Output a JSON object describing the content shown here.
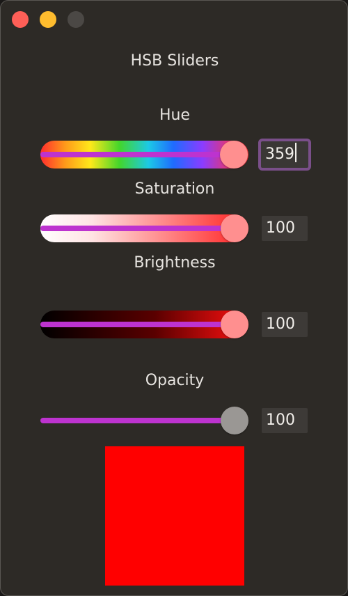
{
  "window": {
    "title": "HSB Sliders"
  },
  "sliders": [
    {
      "id": "hue",
      "label": "Hue",
      "value": "359",
      "max": 359,
      "fraction": 0.9972
    },
    {
      "id": "saturation",
      "label": "Saturation",
      "value": "100",
      "max": 100,
      "fraction": 1.0
    },
    {
      "id": "brightness",
      "label": "Brightness",
      "value": "100",
      "max": 100,
      "fraction": 1.0
    },
    {
      "id": "opacity",
      "label": "Opacity",
      "value": "100",
      "max": 100,
      "fraction": 1.0
    }
  ],
  "colors": {
    "accent_fill": "#bd33cf",
    "knob": "#ff8f8f",
    "knob_opacity": "#9a9794",
    "preview": "#ff0000",
    "focus_ring": "#7a4f8a"
  },
  "icons": {
    "close": "close-button-icon",
    "minimize": "minimize-button-icon",
    "zoom": "zoom-button-icon"
  }
}
